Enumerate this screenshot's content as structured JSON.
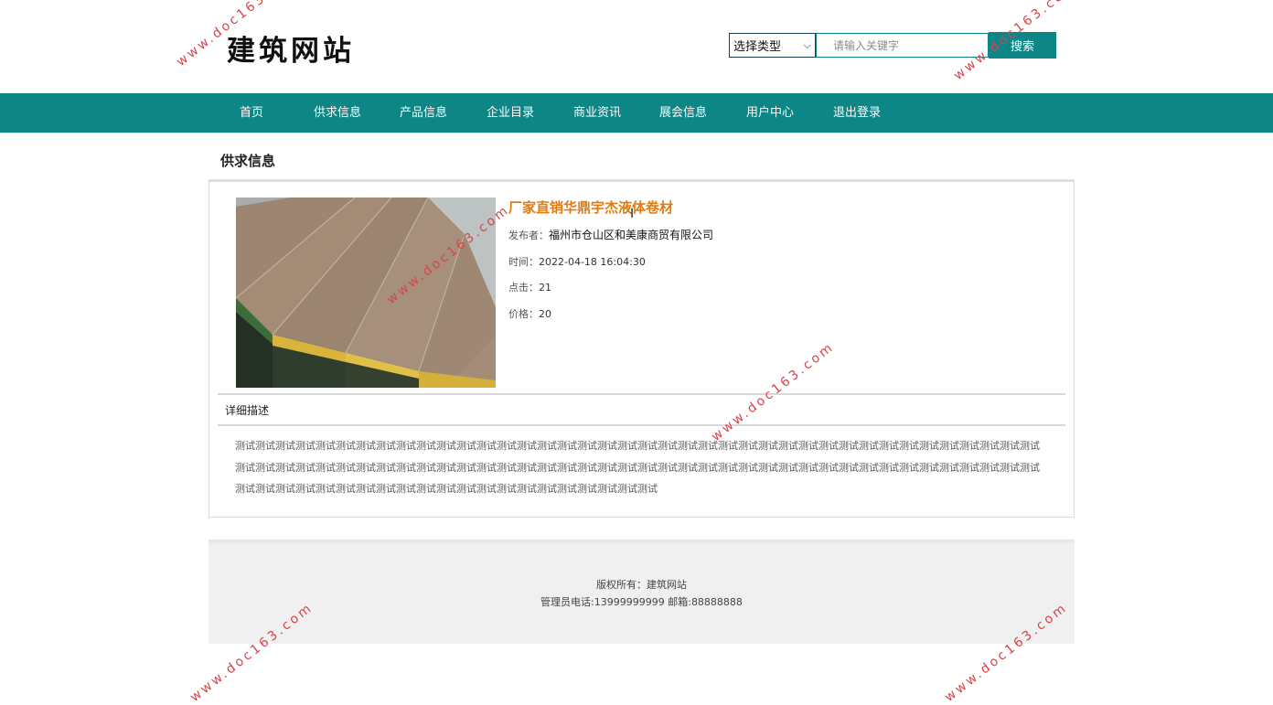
{
  "header": {
    "site_title": "建筑网站",
    "type_select_value": "选择类型",
    "search_placeholder": "请输入关键字",
    "search_button": "搜索"
  },
  "nav": {
    "items": [
      "首页",
      "供求信息",
      "产品信息",
      "企业目录",
      "商业资讯",
      "展会信息",
      "用户中心",
      "退出登录"
    ]
  },
  "section": {
    "title": "供求信息"
  },
  "product": {
    "title": "厂家直销华鼎宇杰液体卷材",
    "publisher_label": "发布者：",
    "publisher": "福州市仓山区和美康商贸有限公司",
    "time_label": "时间：",
    "time": "2022-04-18 16:04:30",
    "clicks_label": "点击：",
    "clicks": "21",
    "price_label": "价格：",
    "price": "20",
    "desc_label": "详细描述",
    "description": "测试测试测试测试测试测试测试测试测试测试测试测试测试测试测试测试测试测试测试测试测试测试测试测试测试测试测试测试测试测试测试测试测试测试测试测试测试测试测试测试测试测试测试测试测试测试测试测试测试测试测试测试测试测试测试测试测试测试测试测试测试测试测试测试测试测试测试测试测试测试测试测试测试测试测试测试测试测试测试测试测试测试测试测试测试测试测试测试测试测试测试测试测试测试测试测试测试测试测试测试测试"
  },
  "footer": {
    "copyright": "版权所有：建筑网站",
    "contact": "管理员电话:13999999999 邮箱:88888888"
  },
  "watermark": "www.doc163.com"
}
